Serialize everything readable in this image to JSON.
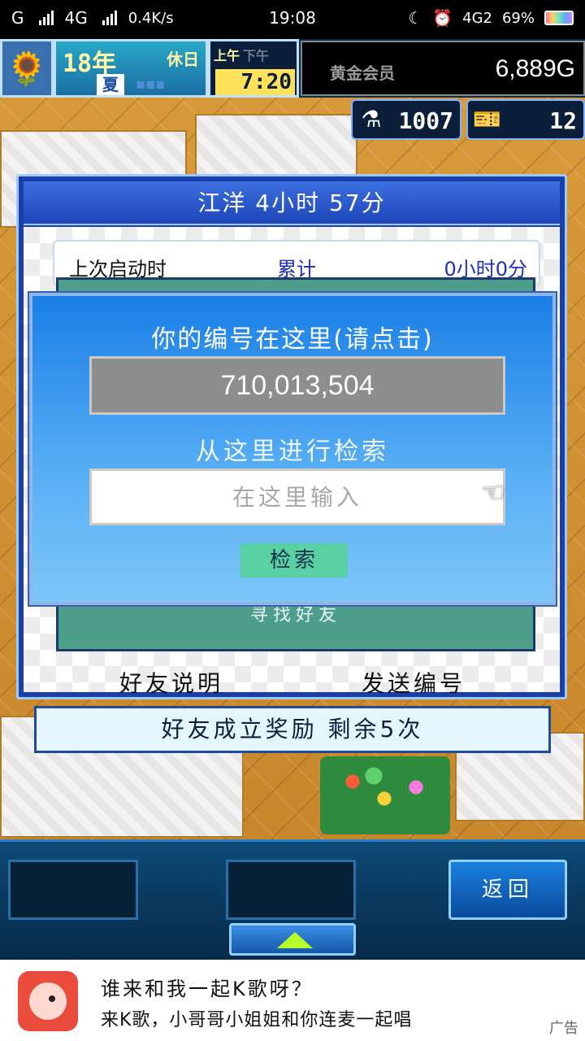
{
  "status_bar": {
    "carrier": "G",
    "network": "4G",
    "speed": "0.4K/s",
    "time": "19:08",
    "network_right": "4G2",
    "battery": "69%"
  },
  "hud": {
    "year": "18年",
    "holiday": "休日",
    "season": "夏",
    "am": "上午",
    "pm": "下午",
    "clock": "7:20",
    "member_label": "黄金会员",
    "gold": "6,889G",
    "research_points": "1007",
    "tickets": "12"
  },
  "dialog": {
    "title": "江洋 4小时 57分",
    "launch_label": "上次启动时",
    "total_label": "累计",
    "total_value": "0小时0分",
    "find_friends": "寻找好友",
    "friend_help": "好友说明",
    "send_id": "发送编号"
  },
  "popup": {
    "heading": "你的编号在这里(请点击)",
    "id_number": "710,013,504",
    "search_label": "从这里进行检索",
    "search_placeholder": "在这里输入",
    "search_button": "检索"
  },
  "bonus": {
    "text": "好友成立奖励 剩余5次"
  },
  "bottom_nav": {
    "back_label": "返回"
  },
  "ad": {
    "title": "谁来和我一起K歌呀？",
    "description": "来K歌，小哥哥小姐姐和你连麦一起唱",
    "tag": "广告"
  },
  "icons": {
    "hud_icon": "sunflower-icon",
    "research": "flask-icon",
    "tickets": "ticket-icon",
    "pointer": "pointing-hand-icon",
    "up": "up-arrow-icon"
  },
  "colors": {
    "popup_top": "#1a7fe6",
    "panel_green": "#4d9f8c",
    "search_button": "#59d1a4",
    "clock_yellow": "#ffe25a"
  }
}
